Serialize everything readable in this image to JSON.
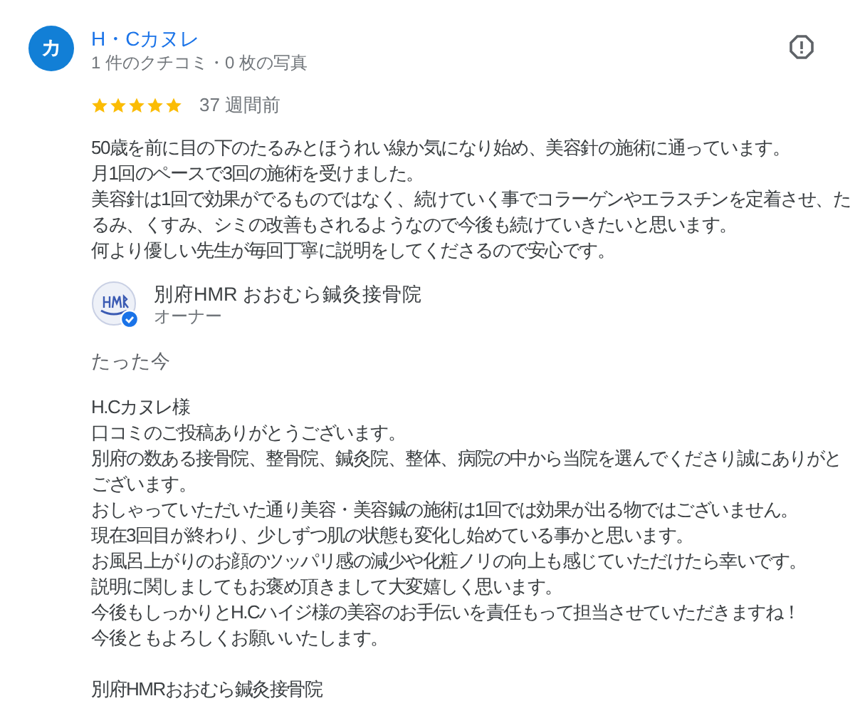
{
  "review": {
    "avatar_letter": "カ",
    "author": "H・Cカヌレ",
    "meta": "1 件のクチコミ・0 枚の写真",
    "stars": 5,
    "time": "37 週間前",
    "lines": [
      "50歳を前に目の下のたるみとほうれい線か気になり始め、美容針の施術に通っています。",
      "月1回のペースで3回の施術を受けました。",
      "美容針は1回で効果がでるものではなく、続けていく事でコラーゲンやエラスチンを定着させ、たるみ、くすみ、シミの改善もされるようなので今後も続けていきたいと思います。",
      "何より優しい先生が毎回丁寧に説明をしてくださるので安心です。"
    ]
  },
  "owner_reply": {
    "name": "別府HMR おおむら鍼灸接骨院",
    "role": "オーナー",
    "verified": true,
    "time": "たった今",
    "lines": [
      "H.Cカヌレ様",
      "口コミのご投稿ありがとうございます。",
      "別府の数ある接骨院、整骨院、鍼灸院、整体、病院の中から当院を選んでくださり誠にありがとございます。",
      "おしゃっていただいた通り美容・美容鍼の施術は1回では効果が出る物ではございません。",
      "現在3回目が終わり、少しずつ肌の状態も変化し始めている事かと思います。",
      "お風呂上がりのお顔のツッパリ感の減少や化粧ノリの向上も感じていただけたら幸いです。",
      "説明に関しましてもお褒め頂きまして大変嬉しく思います。",
      "今後もしっかりとH.Cハイジ様の美容のお手伝いを責任もって担当させていただきますね！",
      "今後ともよろしくお願いいたします。"
    ],
    "signature": "別府HMRおおむら鍼灸接骨院"
  }
}
